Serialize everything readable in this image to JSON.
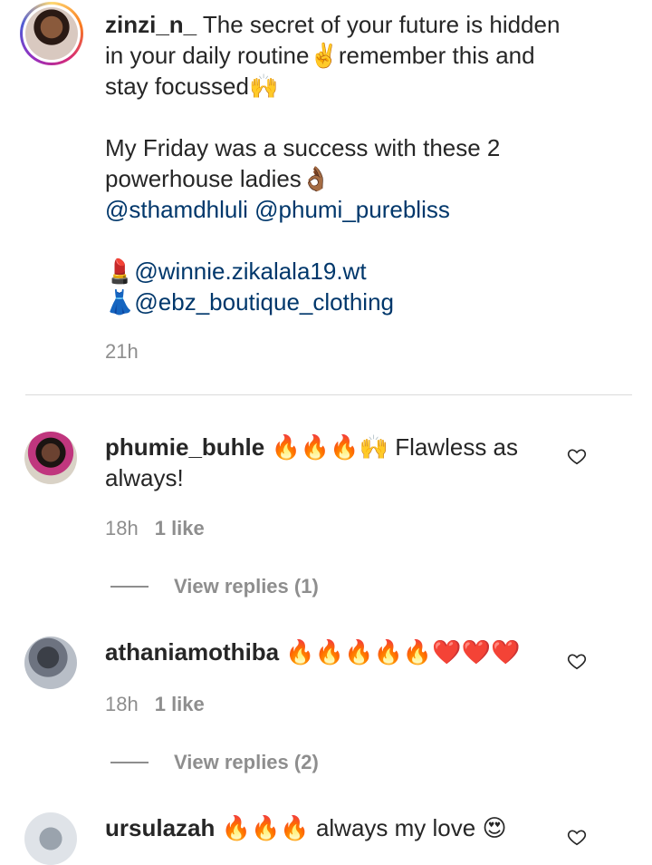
{
  "post": {
    "username": "zinzi_n_",
    "caption_line1": " The secret of your future is hidden",
    "caption_line2": "in your daily routine✌️remember this and",
    "caption_line3": "stay focussed🙌",
    "caption_line4": "My Friday was a success with these 2",
    "caption_line5": "powerhouse ladies👌🏾",
    "mentions_1": "@sthamdhluli @phumi_purebliss",
    "lipstick_emoji": "💄",
    "mention_makeup": "@winnie.zikalala19.wt",
    "dress_emoji": "👗",
    "mention_clothing": "@ebz_boutique_clothing",
    "time": "21h"
  },
  "comments": [
    {
      "username": "phumie_buhle",
      "text_line1": " 🔥🔥🔥🙌 Flawless as",
      "text_line2": "always!",
      "time": "18h",
      "likes": "1 like",
      "view_replies": "View replies (1)"
    },
    {
      "username": "athaniamothiba",
      "text_line1": " 🔥🔥🔥🔥🔥❤️❤️❤️",
      "time": "18h",
      "likes": "1 like",
      "view_replies": "View replies (2)"
    },
    {
      "username": "ursulazah",
      "text_line1": " 🔥🔥🔥 always my love 😍"
    }
  ],
  "icons": {
    "like": "heart-outline-icon"
  },
  "colors": {
    "text": "#262626",
    "mention": "#00376b",
    "muted": "#8e8e8e",
    "divider": "#dbdbdb"
  }
}
